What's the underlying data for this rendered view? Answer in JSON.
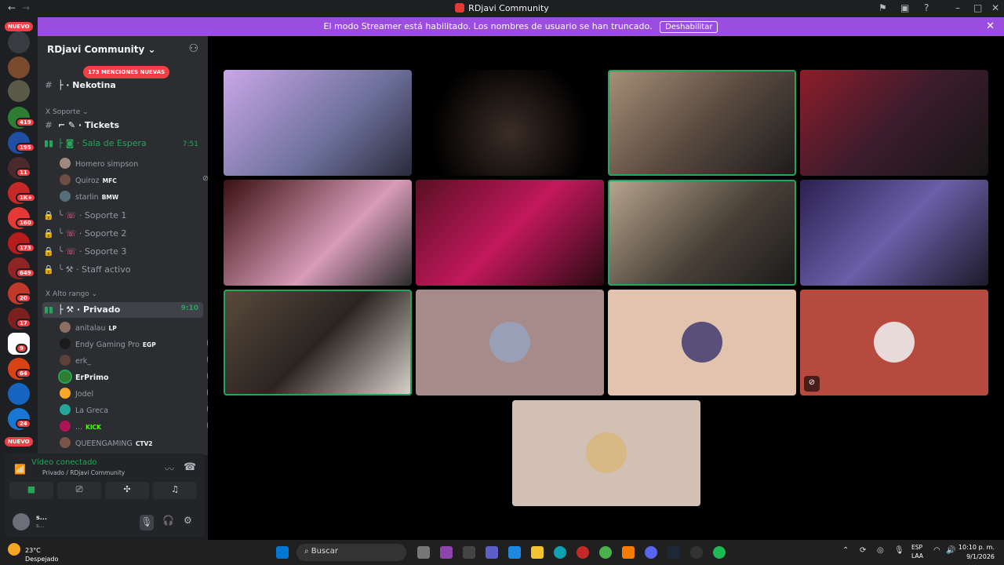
{
  "window": {
    "title": "RDjavi Community",
    "back_icon": "arrow-left-icon",
    "forward_icon": "arrow-right-icon"
  },
  "banner": {
    "text": "El modo Streamer está habilitado. Los nombres de usuario se han truncado.",
    "button": "Deshabilitar"
  },
  "servers": {
    "nuevo_top": "NUEVO",
    "nuevo_bottom": "NUEVO",
    "badges": [
      "419",
      "195",
      "11",
      "1K+",
      "160",
      "173",
      "649",
      "20",
      "17",
      "9",
      "64",
      "24"
    ]
  },
  "sidebar": {
    "server_name": "RDjavi Community",
    "mentions_pill": "173 MENCIONES NUEVAS",
    "channels": {
      "nekotina": "Nekotina",
      "soporte_cat": "Soporte",
      "tickets": "Tickets",
      "sala": "Sala de Espera",
      "sala_time": "7:51",
      "soporte1": "Soporte 1",
      "soporte2": "Soporte 2",
      "soporte3": "Soporte 3",
      "staff": "Staff activo",
      "alto_cat": "Alto rango",
      "privado": "Privado",
      "privado_time": "9:10"
    },
    "sala_users": [
      {
        "name": "Homero simpson",
        "tag": ""
      },
      {
        "name": "Quiroz",
        "tag": "MFC"
      },
      {
        "name": "starlin",
        "tag": "BMW"
      }
    ],
    "privado_users": [
      {
        "name": "anitalau",
        "tag": "LP"
      },
      {
        "name": "Endy Gaming Pro",
        "tag": "EGP"
      },
      {
        "name": "erk_",
        "tag": ""
      },
      {
        "name": "ErPrimo",
        "tag": ""
      },
      {
        "name": "Jodel",
        "tag": ""
      },
      {
        "name": "La Greca",
        "tag": ""
      },
      {
        "name": "...",
        "tag": "KICK"
      },
      {
        "name": "QUEENGAMING",
        "tag": "CTV2"
      }
    ]
  },
  "voice_panel": {
    "status": "Vídeo conectado",
    "location": "Privado / RDjavi Community",
    "user": "s...",
    "user_sub": "s..."
  },
  "taskbar": {
    "temp": "23°C",
    "weather": "Despejado",
    "search": "Buscar",
    "lang_line1": "ESP",
    "lang_line2": "LAA",
    "time": "10:10 p. m.",
    "date": "9/1/2026"
  },
  "colors": {
    "banner": "#9b4de0",
    "speaking": "#23a55a",
    "badge": "#f23f43"
  }
}
